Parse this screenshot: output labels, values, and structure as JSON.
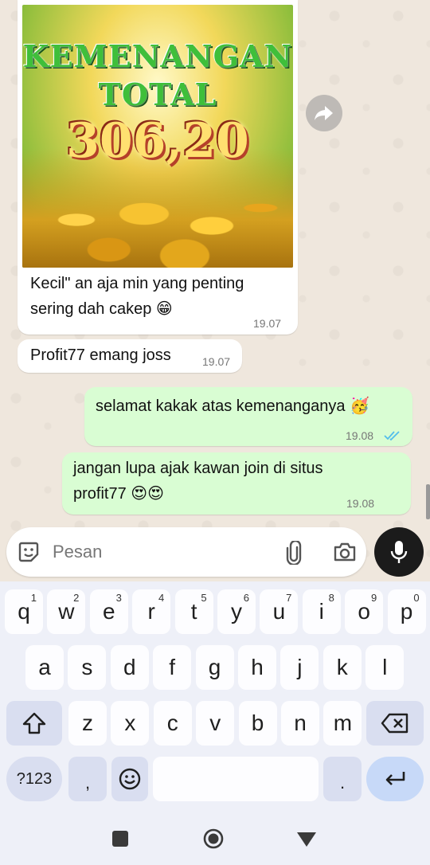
{
  "chat": {
    "image_message": {
      "promo_title_line1": "KEMENANGAN",
      "promo_title_line2": "TOTAL",
      "promo_amount": "306,20",
      "caption": "Kecil\" an aja min yang penting sering dah cakep 😁",
      "time": "19.07"
    },
    "incoming_2": {
      "text": "Profit77 emang joss",
      "time": "19.07"
    },
    "outgoing_1": {
      "text": "selamat kakak atas kemenanganya 🥳",
      "time": "19.08",
      "status": "read"
    },
    "outgoing_2": {
      "text": "jangan lupa ajak kawan join di situs profit77 😍😍",
      "time": "19.08"
    }
  },
  "composer": {
    "placeholder": "Pesan"
  },
  "keyboard": {
    "row1": [
      {
        "k": "q",
        "h": "1"
      },
      {
        "k": "w",
        "h": "2"
      },
      {
        "k": "e",
        "h": "3"
      },
      {
        "k": "r",
        "h": "4"
      },
      {
        "k": "t",
        "h": "5"
      },
      {
        "k": "y",
        "h": "6"
      },
      {
        "k": "u",
        "h": "7"
      },
      {
        "k": "i",
        "h": "8"
      },
      {
        "k": "o",
        "h": "9"
      },
      {
        "k": "p",
        "h": "0"
      }
    ],
    "row2": [
      "a",
      "s",
      "d",
      "f",
      "g",
      "h",
      "j",
      "k",
      "l"
    ],
    "row3": [
      "z",
      "x",
      "c",
      "v",
      "b",
      "n",
      "m"
    ],
    "symbols_label": "?123",
    "comma_label": ",",
    "period_label": "."
  },
  "colors": {
    "incoming_bubble": "#ffffff",
    "outgoing_bubble": "#d9fdd3",
    "read_ticks": "#53bdeb",
    "mic_button": "#1b1b1b"
  }
}
